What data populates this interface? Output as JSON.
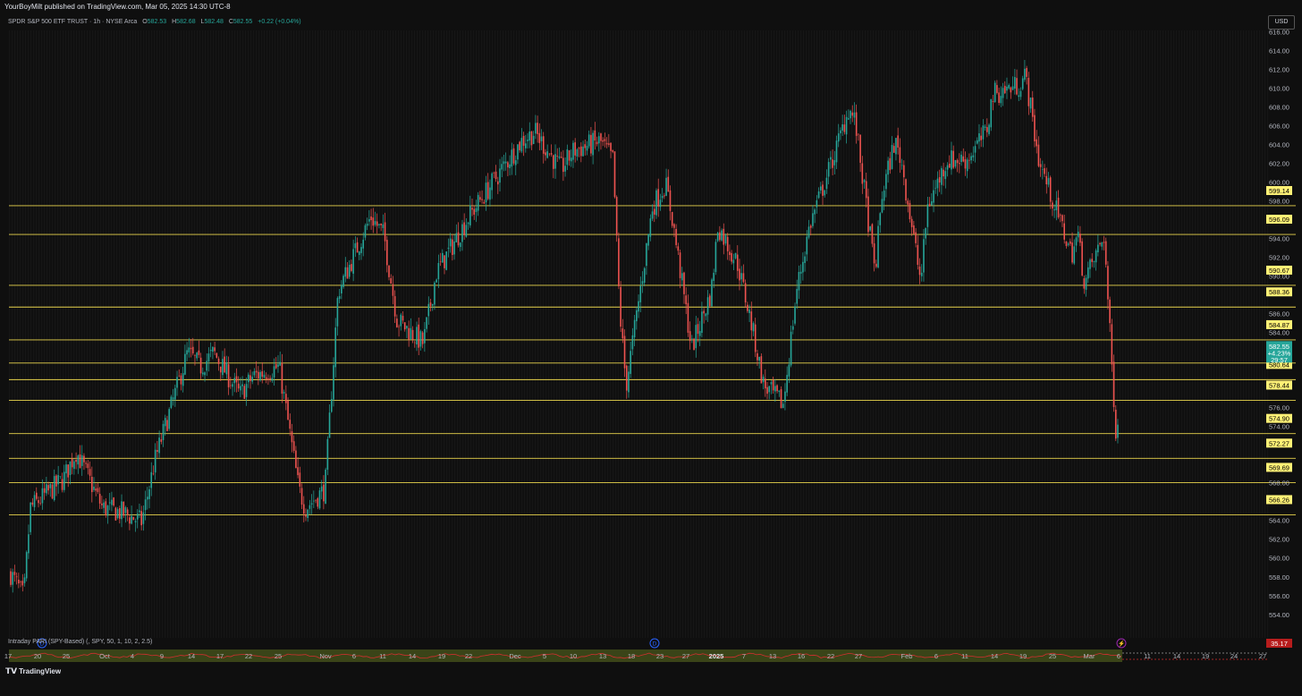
{
  "header": {
    "publisher": "YourBoyMilt published on TradingView.com, Mar 05, 2025 14:30 UTC-8"
  },
  "legend": {
    "symbol": "SPDR S&P 500 ETF TRUST · 1h · NYSE Arca",
    "open_label": "O",
    "open": "582.53",
    "high_label": "H",
    "high": "582.68",
    "low_label": "L",
    "low": "582.48",
    "close_label": "C",
    "close": "582.55",
    "change": "+0.22 (+0.04%)"
  },
  "currency_button": "USD",
  "indicator": {
    "label": "Intraday PARI (SPY-Based) (, SPY, 50, 1, 10, 2, 2.5)",
    "value": "35.17"
  },
  "footer": {
    "logo_text": "TradingView"
  },
  "event_markers": [
    "D",
    "D",
    "⚡"
  ],
  "current_price_badge": {
    "price": "582.55",
    "change": "+4.23%",
    "countdown": "29:57"
  },
  "colors": {
    "background": "#0f0f0f",
    "level_line": "#e8d44d",
    "level_tag_bg": "#fff176",
    "up_candle": "#26a69a",
    "down_candle": "#ef5350",
    "current_price_bg": "#26a69a",
    "indicator_band": "#3a4418"
  },
  "chart_data": {
    "type": "candlestick",
    "symbol": "SPY",
    "timeframe": "1h",
    "y_axis": {
      "ylim": [
        552.6,
        617.6
      ],
      "ticks": [
        "616.00",
        "614.00",
        "612.00",
        "610.00",
        "608.00",
        "606.00",
        "604.00",
        "602.00",
        "600.00",
        "598.00",
        "594.00",
        "592.00",
        "590.00",
        "586.00",
        "584.00",
        "576.00",
        "574.00",
        "568.00",
        "564.00",
        "562.00",
        "560.00",
        "558.00",
        "556.00",
        "554.00"
      ]
    },
    "x_axis": {
      "labels": [
        "17",
        "20",
        "25",
        "Oct",
        "4",
        "9",
        "14",
        "17",
        "22",
        "25",
        "Nov",
        "6",
        "11",
        "14",
        "19",
        "22",
        "Dec",
        "5",
        "10",
        "13",
        "18",
        "23",
        "27",
        "2025",
        "7",
        "13",
        "16",
        "22",
        "27",
        "Feb",
        "6",
        "11",
        "14",
        "19",
        "25",
        "Mar",
        "6",
        "11",
        "14",
        "19",
        "24",
        "27"
      ]
    },
    "horizontal_levels": [
      "599.14",
      "596.09",
      "590.67",
      "588.36",
      "584.87",
      "582.41",
      "580.64",
      "578.44",
      "574.90",
      "572.27",
      "569.69",
      "566.26"
    ],
    "current_price": 582.55,
    "price_path_anchors": [
      {
        "x": "Sep 17",
        "y": 560.0
      },
      {
        "x": "Sep 19",
        "y": 557.5
      },
      {
        "x": "Sep 20",
        "y": 567.0
      },
      {
        "x": "Sep 25",
        "y": 570.0
      },
      {
        "x": "Sep 27",
        "y": 573.0
      },
      {
        "x": "Oct 1",
        "y": 567.0
      },
      {
        "x": "Oct 4",
        "y": 566.5
      },
      {
        "x": "Oct 7",
        "y": 565.5
      },
      {
        "x": "Oct 9",
        "y": 572.0
      },
      {
        "x": "Oct 14",
        "y": 583.5
      },
      {
        "x": "Oct 16",
        "y": 582.0
      },
      {
        "x": "Oct 18",
        "y": 583.5
      },
      {
        "x": "Oct 22",
        "y": 579.0
      },
      {
        "x": "Oct 24",
        "y": 581.0
      },
      {
        "x": "Oct 28",
        "y": 582.0
      },
      {
        "x": "Oct 31",
        "y": 569.0
      },
      {
        "x": "Nov 1",
        "y": 567.0
      },
      {
        "x": "Nov 4",
        "y": 569.0
      },
      {
        "x": "Nov 6",
        "y": 590.0
      },
      {
        "x": "Nov 11",
        "y": 598.0
      },
      {
        "x": "Nov 13",
        "y": 596.0
      },
      {
        "x": "Nov 15",
        "y": 587.0
      },
      {
        "x": "Nov 19",
        "y": 584.5
      },
      {
        "x": "Nov 21",
        "y": 592.0
      },
      {
        "x": "Nov 26",
        "y": 598.0
      },
      {
        "x": "Nov 29",
        "y": 601.0
      },
      {
        "x": "Dec 4",
        "y": 606.0
      },
      {
        "x": "Dec 6",
        "y": 607.0
      },
      {
        "x": "Dec 10",
        "y": 603.0
      },
      {
        "x": "Dec 12",
        "y": 605.0
      },
      {
        "x": "Dec 16",
        "y": 606.0
      },
      {
        "x": "Dec 18",
        "y": 604.0
      },
      {
        "x": "Dec 19",
        "y": 588.0
      },
      {
        "x": "Dec 20",
        "y": 580.0
      },
      {
        "x": "Dec 24",
        "y": 599.0
      },
      {
        "x": "Dec 26",
        "y": 601.5
      },
      {
        "x": "Dec 27",
        "y": 598.0
      },
      {
        "x": "Dec 30",
        "y": 584.0
      },
      {
        "x": "Jan 2",
        "y": 590.0
      },
      {
        "x": "Jan 3",
        "y": 597.0
      },
      {
        "x": "Jan 6",
        "y": 593.0
      },
      {
        "x": "Jan 8",
        "y": 587.0
      },
      {
        "x": "Jan 10",
        "y": 580.0
      },
      {
        "x": "Jan 13",
        "y": 578.0
      },
      {
        "x": "Jan 15",
        "y": 590.0
      },
      {
        "x": "Jan 17",
        "y": 597.0
      },
      {
        "x": "Jan 21",
        "y": 605.0
      },
      {
        "x": "Jan 23",
        "y": 609.5
      },
      {
        "x": "Jan 24",
        "y": 608.0
      },
      {
        "x": "Jan 27",
        "y": 592.0
      },
      {
        "x": "Jan 28",
        "y": 600.0
      },
      {
        "x": "Jan 30",
        "y": 606.0
      },
      {
        "x": "Jan 31",
        "y": 604.0
      },
      {
        "x": "Feb 3",
        "y": 591.0
      },
      {
        "x": "Feb 4",
        "y": 599.0
      },
      {
        "x": "Feb 7",
        "y": 604.0
      },
      {
        "x": "Feb 10",
        "y": 604.0
      },
      {
        "x": "Feb 13",
        "y": 607.0
      },
      {
        "x": "Feb 14",
        "y": 611.0
      },
      {
        "x": "Feb 18",
        "y": 612.0
      },
      {
        "x": "Feb 19",
        "y": 613.0
      },
      {
        "x": "Feb 21",
        "y": 604.0
      },
      {
        "x": "Feb 24",
        "y": 598.0
      },
      {
        "x": "Feb 26",
        "y": 594.0
      },
      {
        "x": "Feb 27",
        "y": 596.0
      },
      {
        "x": "Feb 28",
        "y": 591.0
      },
      {
        "x": "Mar 3",
        "y": 596.0
      },
      {
        "x": "Mar 4",
        "y": 584.0
      },
      {
        "x": "Mar 5",
        "y": 573.0
      },
      {
        "x": "Mar 5 14:00",
        "y": 576.5
      },
      {
        "x": "Mar 5 14:30",
        "y": 582.55
      }
    ]
  }
}
